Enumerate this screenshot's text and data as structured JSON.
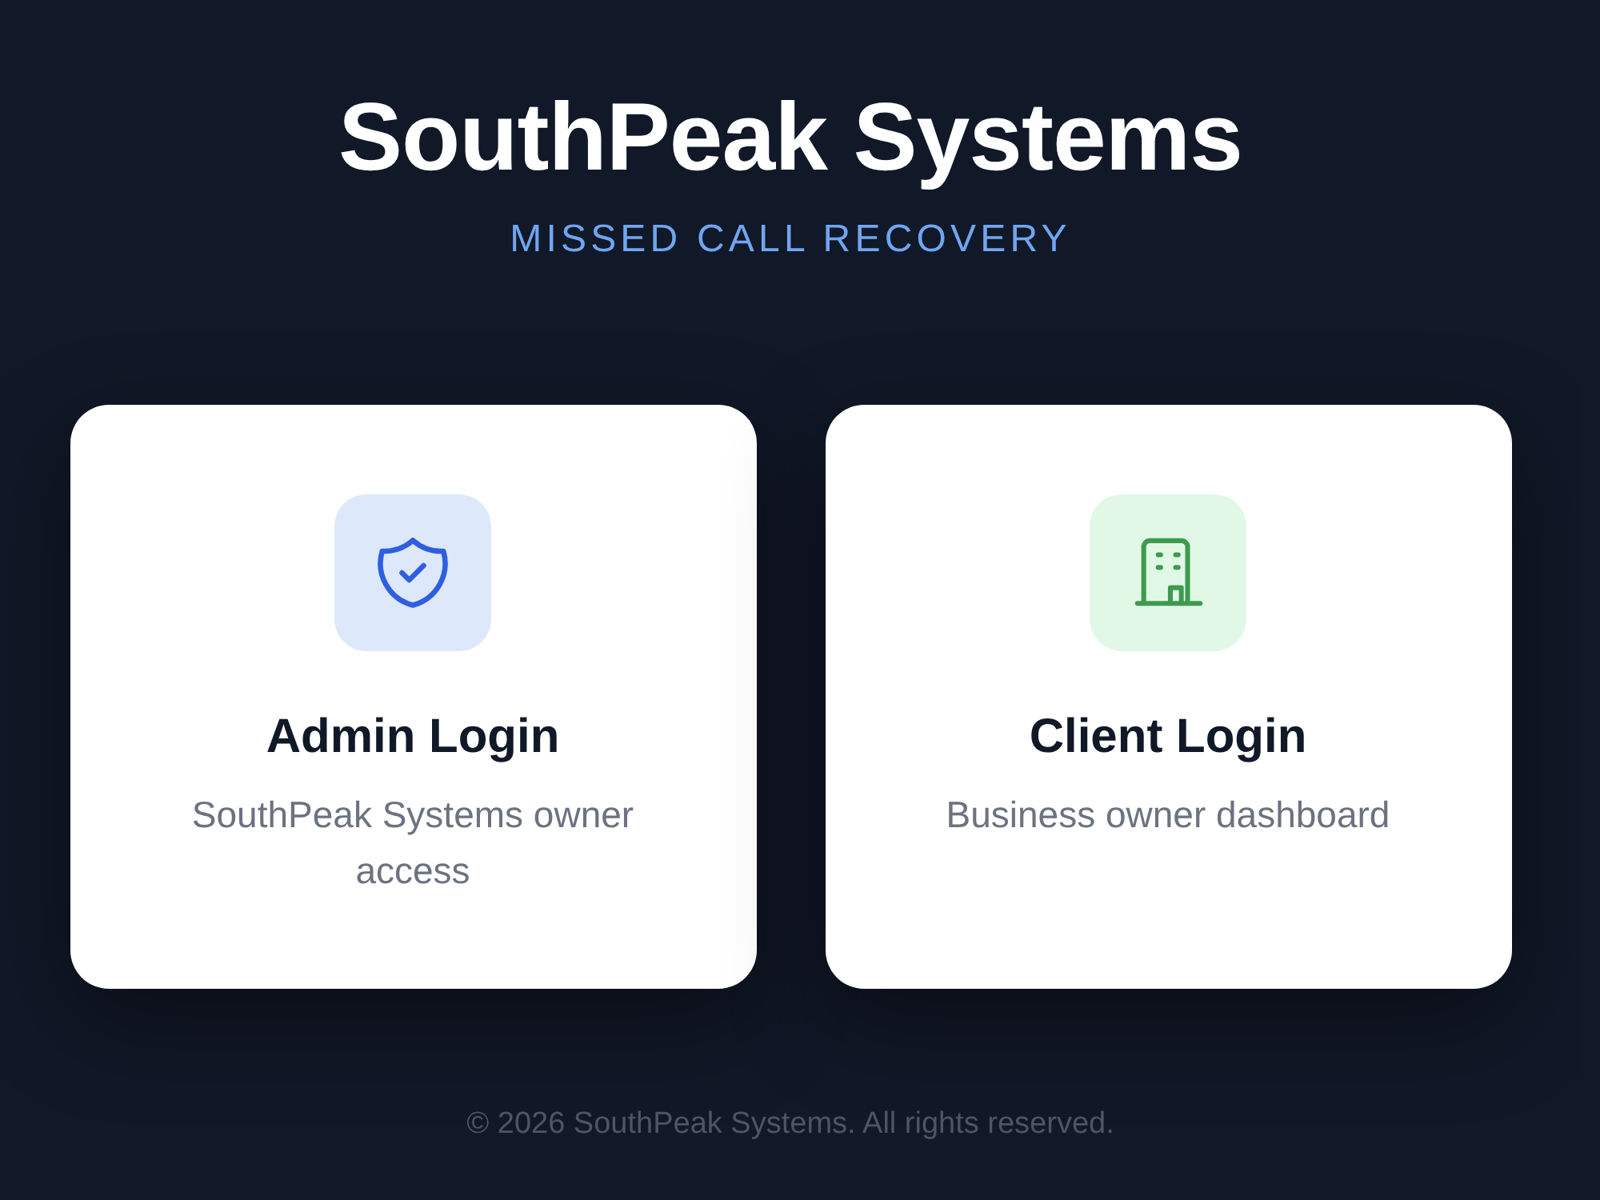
{
  "header": {
    "title": "SouthPeak Systems",
    "subtitle": "MISSED CALL RECOVERY"
  },
  "cards": [
    {
      "kind": "admin",
      "title": "Admin Login",
      "description": "SouthPeak Systems owner access"
    },
    {
      "kind": "client",
      "title": "Client Login",
      "description": "Business owner dashboard"
    }
  ],
  "footer": {
    "text": "© 2026 SouthPeak Systems. All rights reserved."
  }
}
